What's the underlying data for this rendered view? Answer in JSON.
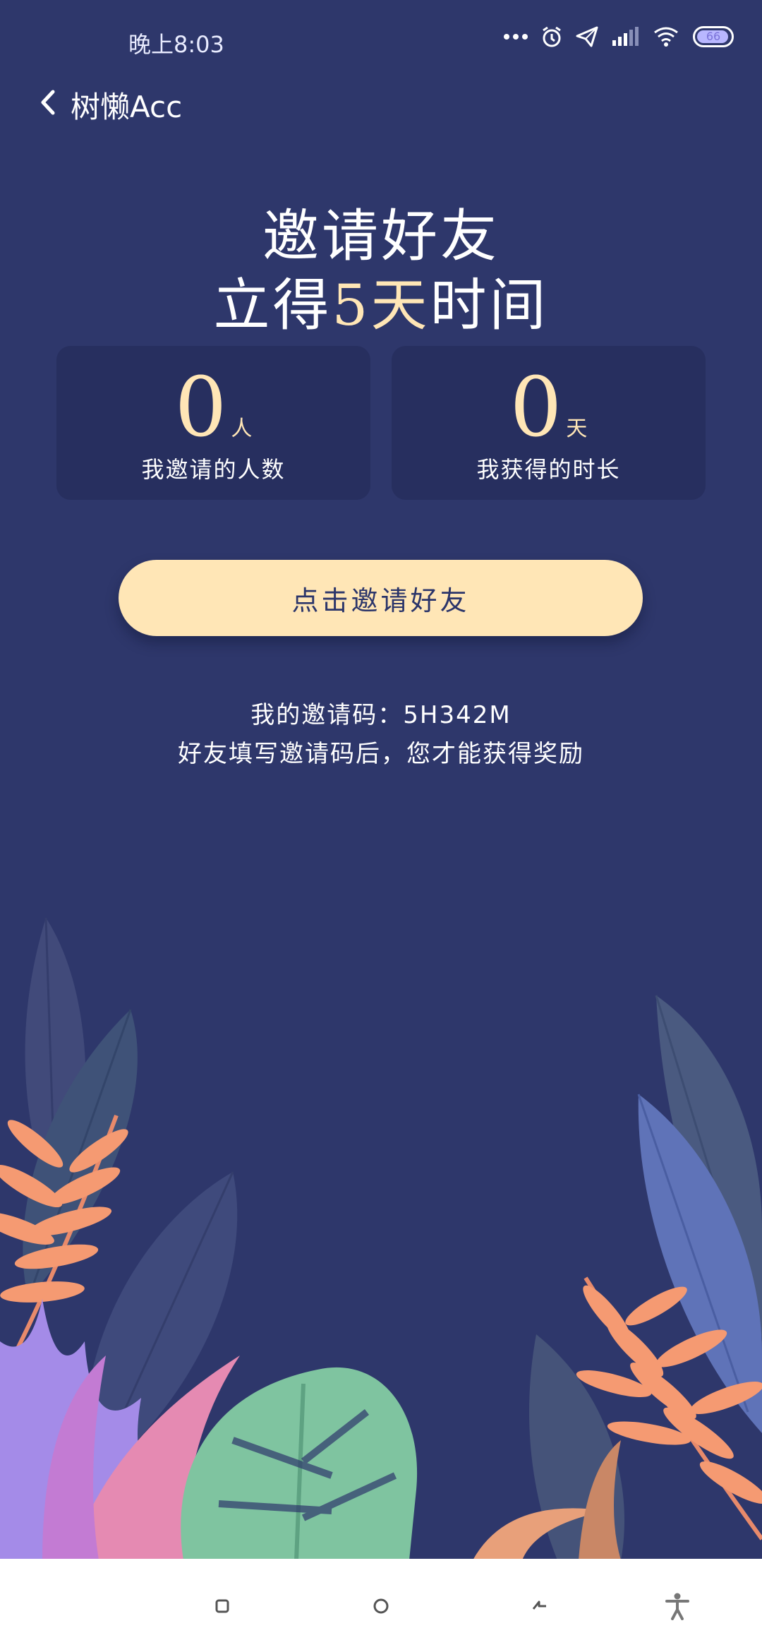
{
  "status_bar": {
    "time": "晚上8:03",
    "icons": [
      "more-dots-icon",
      "alarm-icon",
      "send-icon",
      "signal-icon",
      "wifi-icon",
      "battery-icon"
    ],
    "battery_level": "66"
  },
  "app_bar": {
    "back_icon": "chevron-left-icon",
    "title": "树懒Acc"
  },
  "hero": {
    "line1": "邀请好友",
    "line2_prefix": "立得",
    "line2_accent": "5天",
    "line2_suffix": "时间"
  },
  "stats": [
    {
      "value": "0",
      "unit": "人",
      "label": "我邀请的人数"
    },
    {
      "value": "0",
      "unit": "天",
      "label": "我获得的时长"
    }
  ],
  "invite_button": {
    "label": "点击邀请好友"
  },
  "invite_code": {
    "text": "我的邀请码：5H342M"
  },
  "hint": {
    "text": "好友填写邀请码后，您才能获得奖励"
  },
  "nav_bar": {
    "icons": [
      "recent-apps-icon",
      "home-icon",
      "back-icon",
      "accessibility-icon"
    ]
  },
  "colors": {
    "background": "#2e376b",
    "card": "#272f5f",
    "accent": "#ffe6b6",
    "button_text": "#2b356a"
  }
}
